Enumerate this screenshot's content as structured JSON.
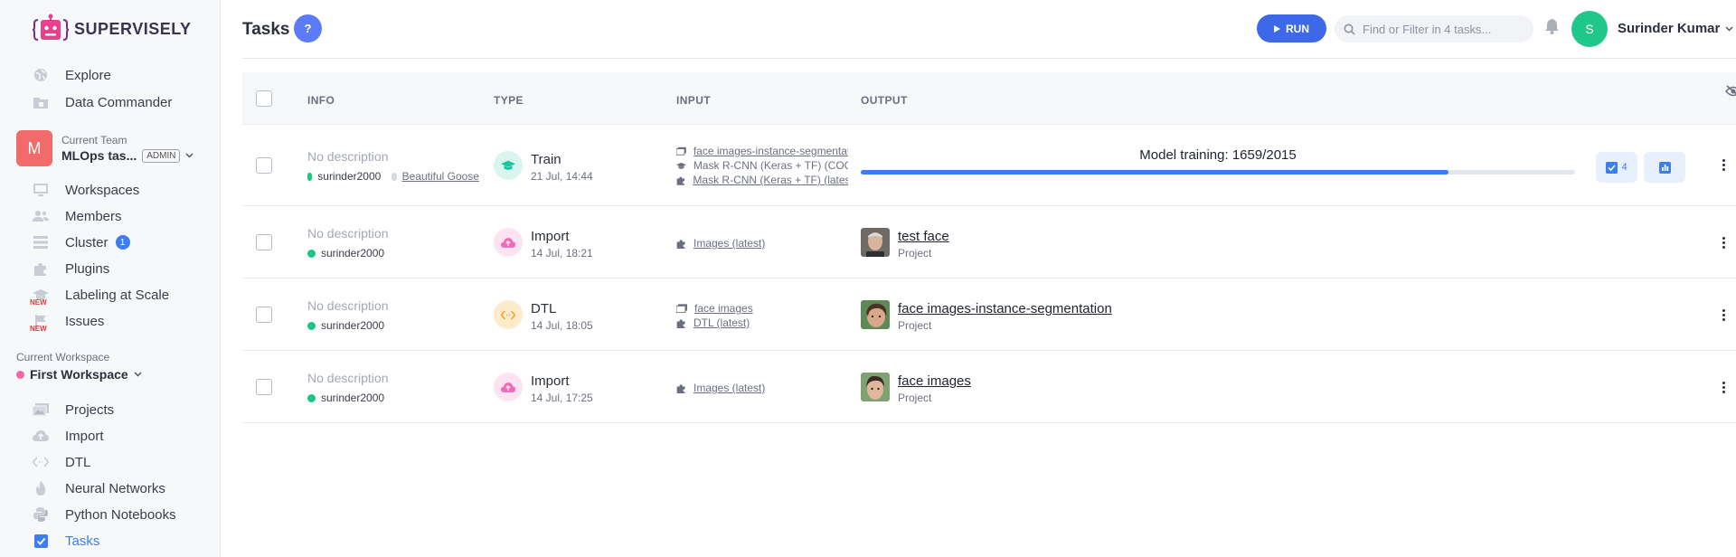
{
  "brand": {
    "name": "SUPERVISELY"
  },
  "sidebar": {
    "top_items": [
      {
        "label": "Explore",
        "icon": "globe-icon"
      },
      {
        "label": "Data Commander",
        "icon": "folder-icon"
      }
    ],
    "team": {
      "caption": "Current Team",
      "avatar_letter": "M",
      "name": "MLOps tas...",
      "role": "ADMIN"
    },
    "team_items": [
      {
        "label": "Workspaces",
        "icon": "monitor-icon"
      },
      {
        "label": "Members",
        "icon": "users-icon"
      },
      {
        "label": "Cluster",
        "icon": "cluster-icon",
        "badge": "1"
      },
      {
        "label": "Plugins",
        "icon": "puzzle-icon"
      },
      {
        "label": "Labeling at Scale",
        "icon": "graduation-cap-icon",
        "tag": "NEW"
      },
      {
        "label": "Issues",
        "icon": "flag-icon",
        "tag": "NEW"
      }
    ],
    "workspace": {
      "caption": "Current Workspace",
      "name": "First Workspace"
    },
    "workspace_items": [
      {
        "label": "Projects",
        "icon": "images-icon"
      },
      {
        "label": "Import",
        "icon": "cloud-upload-icon"
      },
      {
        "label": "DTL",
        "icon": "code-arrows-icon"
      },
      {
        "label": "Neural Networks",
        "icon": "flame-icon"
      },
      {
        "label": "Python Notebooks",
        "icon": "python-icon"
      },
      {
        "label": "Tasks",
        "icon": "checkbox-icon",
        "active": true
      }
    ]
  },
  "header": {
    "title": "Tasks",
    "help": "?",
    "run_label": "RUN",
    "search_placeholder": "Find or Filter in 4 tasks...",
    "user": {
      "initial": "S",
      "name": "Surinder Kumar"
    }
  },
  "table": {
    "columns": [
      "INFO",
      "TYPE",
      "INPUT",
      "OUTPUT"
    ],
    "rows": [
      {
        "description": "No description",
        "owner": "surinder2000",
        "session": "Beautiful Goose",
        "type": "Train",
        "date": "21 Jul, 14:44",
        "inputs": [
          {
            "text": "face images-instance-segmentation",
            "icon": "images-icon",
            "underline": true
          },
          {
            "text": "Mask R-CNN (Keras + TF) (COCO)",
            "icon": "graduation-cap-icon",
            "underline": false
          },
          {
            "text": "Mask R-CNN (Keras + TF) (latest)",
            "icon": "puzzle-icon",
            "underline": true
          }
        ],
        "progress": {
          "label": "Model training: 1659/2015",
          "value": 0.8233
        },
        "actions": {
          "checks_count": "4"
        }
      },
      {
        "description": "No description",
        "owner": "surinder2000",
        "type": "Import",
        "date": "14 Jul, 18:21",
        "inputs": [
          {
            "text": "Images (latest)",
            "icon": "puzzle-icon",
            "underline": true
          }
        ],
        "output": {
          "name": "test face",
          "kind": "Project"
        }
      },
      {
        "description": "No description",
        "owner": "surinder2000",
        "type": "DTL",
        "date": "14 Jul, 18:05",
        "inputs": [
          {
            "text": "face images",
            "icon": "images-icon",
            "underline": true
          },
          {
            "text": "DTL (latest)",
            "icon": "puzzle-icon",
            "underline": true
          }
        ],
        "output": {
          "name": "face images-instance-segmentation",
          "kind": "Project"
        }
      },
      {
        "description": "No description",
        "owner": "surinder2000",
        "type": "Import",
        "date": "14 Jul, 17:25",
        "inputs": [
          {
            "text": "Images (latest)",
            "icon": "puzzle-icon",
            "underline": true
          }
        ],
        "output": {
          "name": "face images",
          "kind": "Project"
        }
      }
    ]
  },
  "colors": {
    "accent": "#3c7ef0",
    "run_button": "#3d68e8",
    "online_dot": "#19c784",
    "team_avatar": "#f26b6b",
    "user_avatar": "#1fc88a"
  }
}
